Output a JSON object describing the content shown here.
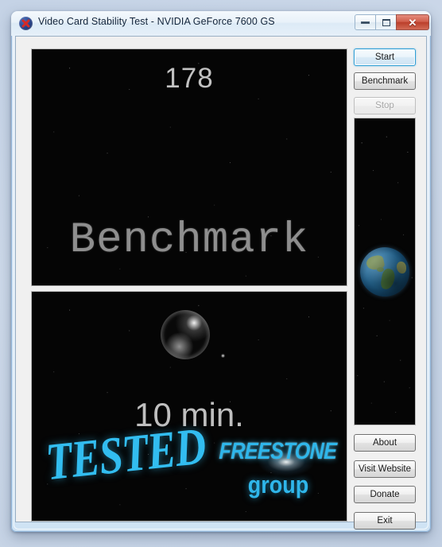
{
  "window": {
    "title": "Video Card Stability Test - NVIDIA GeForce 7600 GS",
    "icon": "red-x-circle-icon",
    "controls": {
      "minimize": "minimize-icon",
      "maximize": "maximize-icon",
      "close": "✕"
    }
  },
  "render": {
    "fps": "178",
    "mode_label": "Benchmark",
    "elapsed": "10 min.",
    "tested_badge": "TESTED",
    "brand_name": "FREESTONE",
    "brand_suffix": "group"
  },
  "buttons": {
    "start": "Start",
    "benchmark": "Benchmark",
    "stop": "Stop",
    "about": "About",
    "visit_website": "Visit Website",
    "donate": "Donate",
    "exit": "Exit"
  },
  "colors": {
    "accent_cyan": "#2fb6ea",
    "render_background": "#050505",
    "client_background": "#f0f0f0",
    "close_button": "#bb3f2b",
    "focus_border": "#2f9ed4",
    "text_gray": "#c2c2c2"
  }
}
